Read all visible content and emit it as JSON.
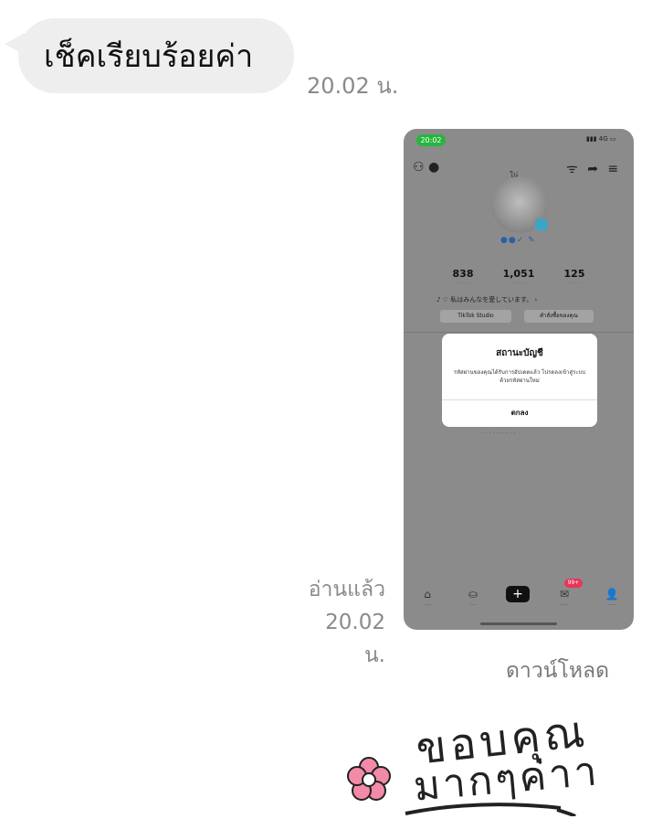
{
  "messages": {
    "incoming": {
      "text": "เช็คเรียบร้อยค่า",
      "time": "20.02 น."
    },
    "image_message": {
      "read_label": "อ่านแล้ว",
      "time": "20.02 น.",
      "download_label": "ดาวน์โหลด",
      "screenshot": {
        "status_time": "20:02",
        "status_right": "▮▮▮ 4G ▭",
        "username": "ใน่",
        "stats": [
          {
            "value": "838"
          },
          {
            "value": "1,051"
          },
          {
            "value": "125"
          }
        ],
        "bio": "♪ ♡ 私はみんなを愛しています。 ›",
        "buttons": [
          "TikTok Studio",
          "คำสั่งซื้อของคุณ"
        ],
        "dialog": {
          "title": "สถานะบัญชี",
          "body": "รหัสผ่านของคุณได้รับการอัปเดตแล้ว โปรดลงเข้าสู่ระบบด้วยรหัสผ่านใหม่",
          "ok": "ตกลง"
        },
        "inbox_badge": "99+"
      }
    },
    "sticker": {
      "line1": "ขอบคุณ",
      "line2": "มากๆค่าา"
    }
  },
  "colors": {
    "bubble": "#eeeeee",
    "meta_text": "#8a8a8a",
    "sticker_flower": "#f28aa8"
  }
}
